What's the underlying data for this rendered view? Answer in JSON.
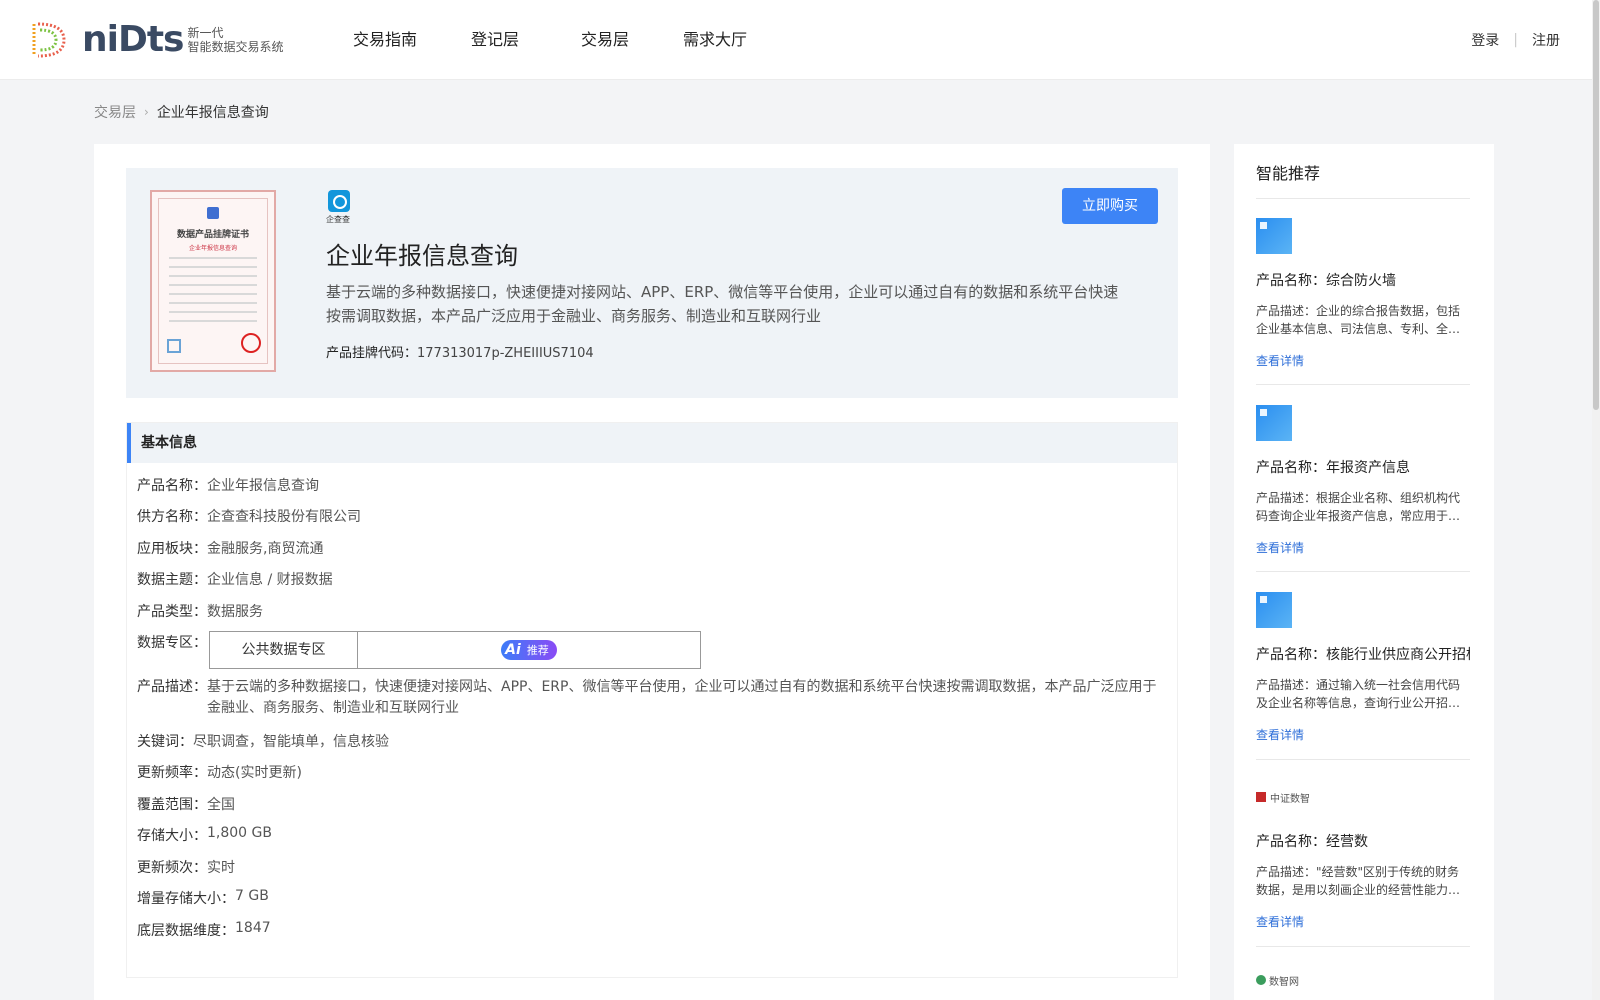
{
  "header": {
    "logo_word": "niDts",
    "logo_sub1": "新一代",
    "logo_sub2": "智能数据交易系统",
    "nav": [
      "交易指南",
      "登记层",
      "交易层",
      "需求大厅"
    ],
    "login": "登录",
    "register": "注册"
  },
  "breadcrumb": {
    "parent": "交易层",
    "current": "企业年报信息查询"
  },
  "hero": {
    "cert_title": "数据产品挂牌证书",
    "cert_sub": "企业年报信息查询",
    "brand": "企查查",
    "title": "企业年报信息查询",
    "desc": "基于云端的多种数据接口，快速便捷对接网站、APP、ERP、微信等平台使用，企业可以通过自有的数据和系统平台快速按需调取数据，本产品广泛应用于金融业、商务服务、制造业和互联网行业",
    "code_label": "产品挂牌代码：",
    "code_value": "177313017p-ZHEIIIUS7104",
    "buy": "立即购买"
  },
  "info": {
    "heading": "基本信息",
    "rows": {
      "name": {
        "label": "产品名称：",
        "value": "企业年报信息查询"
      },
      "supplier": {
        "label": "供方名称：",
        "value": "企查查科技股份有限公司"
      },
      "sector": {
        "label": "应用板块：",
        "value": "金融服务,商贸流通"
      },
      "theme": {
        "label": "数据主题：",
        "value": "企业信息 / 财报数据"
      },
      "type": {
        "label": "产品类型：",
        "value": "数据服务"
      },
      "zone": {
        "label": "数据专区：",
        "value": "公共数据专区",
        "ai": "Ai",
        "ai_tag": "推荐"
      },
      "desc": {
        "label": "产品描述：",
        "value": "基于云端的多种数据接口，快速便捷对接网站、APP、ERP、微信等平台使用，企业可以通过自有的数据和系统平台快速按需调取数据，本产品广泛应用于金融业、商务服务、制造业和互联网行业"
      },
      "keywords": {
        "label": "关键词：",
        "value": "尽职调查，智能填单，信息核验"
      },
      "freq": {
        "label": "更新频率：",
        "value": "动态(实时更新)"
      },
      "coverage": {
        "label": "覆盖范围：",
        "value": "全国"
      },
      "storage": {
        "label": "存储大小：",
        "value": "1,800 GB"
      },
      "update_times": {
        "label": "更新频次：",
        "value": "实时"
      },
      "incr": {
        "label": "增量存储大小：",
        "value": "7 GB"
      },
      "dims": {
        "label": "底层数据维度：",
        "value": "1847"
      }
    }
  },
  "sidebar": {
    "title": "智能推荐",
    "link": "查看详情",
    "items": [
      {
        "name": "产品名称：综合防火墙",
        "desc": "产品描述：企业的综合报告数据，包括企业基本信息、司法信息、专利、全…"
      },
      {
        "name": "产品名称：年报资产信息",
        "desc": "产品描述：根据企业名称、组织机构代码查询企业年报资产信息，常应用于…"
      },
      {
        "name": "产品名称：核能行业供应商公开招标",
        "desc": "产品描述：通过输入统一社会信用代码及企业名称等信息，查询行业公开招…"
      },
      {
        "name": "产品名称：经营数",
        "desc": "产品描述：\"经营数\"区别于传统的财务数据，是用以刻画企业的经营性能力…",
        "logo": "中证数智"
      }
    ],
    "last_logo": "数智网"
  }
}
